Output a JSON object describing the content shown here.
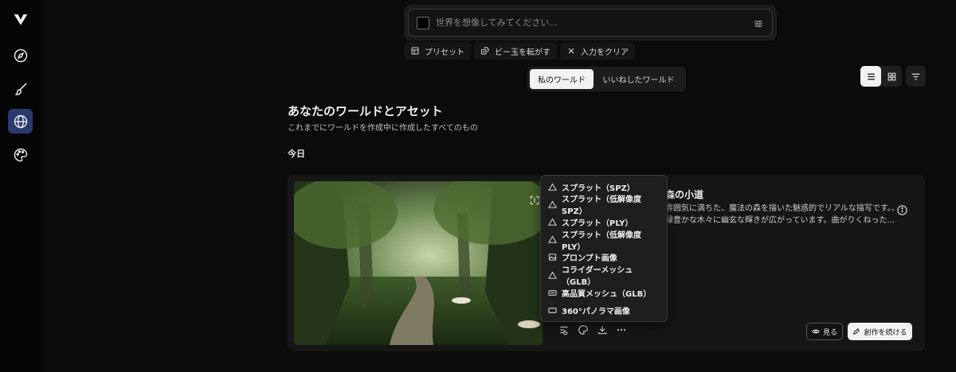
{
  "prompt": {
    "placeholder": "世界を想像してみてください..."
  },
  "chips": [
    {
      "label": "プリセット",
      "icon": "layout-icon"
    },
    {
      "label": "ビー玉を転がす",
      "icon": "dice-icon"
    },
    {
      "label": "入力をクリア",
      "icon": "close-icon"
    }
  ],
  "tabs": {
    "mine": "私のワールド",
    "liked": "いいねしたワールド"
  },
  "page": {
    "title": "あなたのワールドとアセット",
    "subtitle": "これまでにワールドを作成中に作成したすべてのもの",
    "section": "今日"
  },
  "card": {
    "title": "森の小道",
    "description": "雰囲気に満ちた、魔法の森を描いた魅惑的でリアルな描写です。、緑豊かな木々に幽玄な輝きが広がっています。曲がりくねった...",
    "view_label": "見る",
    "continue_label": "創作を続ける"
  },
  "menu": [
    {
      "label": "スプラット（SPZ）",
      "icon": "triangle-icon"
    },
    {
      "label": "スプラット（低解像度SPZ）",
      "icon": "triangle-icon"
    },
    {
      "label": "スプラット（PLY）",
      "icon": "triangle-icon"
    },
    {
      "label": "スプラット（低解像度PLY）",
      "icon": "triangle-icon"
    },
    {
      "label": "プロンプト画像",
      "icon": "image-icon"
    },
    {
      "label": "コライダーメッシュ（GLB）",
      "icon": "triangle-icon"
    },
    {
      "label": "高品質メッシュ（GLB）",
      "icon": "mesh-icon"
    },
    {
      "label": "360°パノラマ画像",
      "icon": "panorama-icon"
    }
  ],
  "colors": {
    "active_sidebar": "#2a3a6e",
    "background": "#0b0b0b",
    "card": "#161616"
  }
}
